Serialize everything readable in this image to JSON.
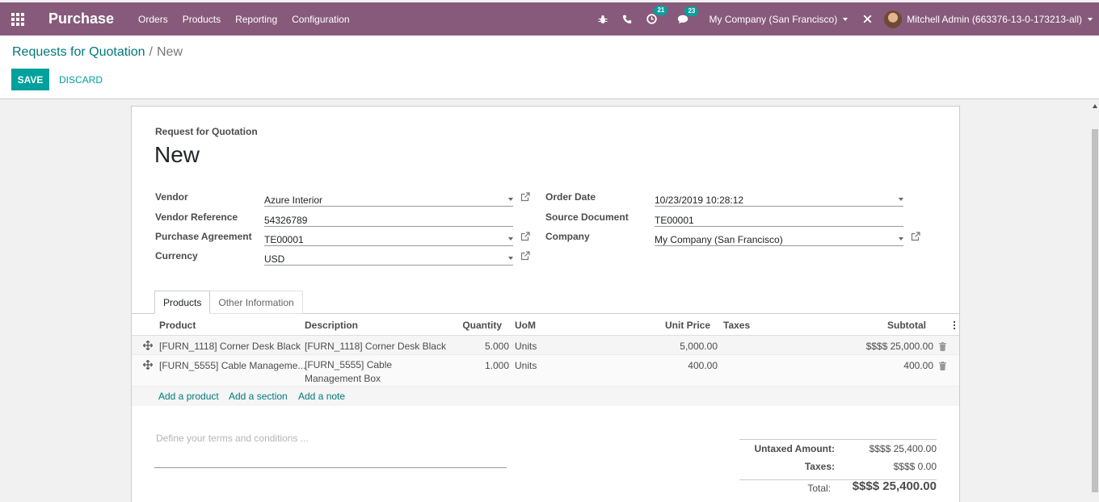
{
  "navbar": {
    "app_name": "Purchase",
    "menu": [
      "Orders",
      "Products",
      "Reporting",
      "Configuration"
    ],
    "activity_count": "21",
    "message_count": "23",
    "company": "My Company (San Francisco)",
    "user": "Mitchell Admin (663376-13-0-173213-all)",
    "icons": [
      "apps-grid-icon",
      "bug-icon",
      "phone-icon",
      "activity-clock-icon",
      "chat-icon",
      "close-icon",
      "user-avatar"
    ]
  },
  "breadcrumb": {
    "parent": "Requests for Quotation",
    "separator": "/",
    "current": "New"
  },
  "buttons": {
    "save": "SAVE",
    "discard": "DISCARD"
  },
  "form": {
    "subtitle": "Request for Quotation",
    "title": "New",
    "left_fields": [
      {
        "label": "Vendor",
        "value": "Azure Interior"
      },
      {
        "label": "Vendor Reference",
        "value": "54326789"
      },
      {
        "label": "Purchase Agreement",
        "value": "TE00001"
      },
      {
        "label": "Currency",
        "value": "USD"
      }
    ],
    "right_fields": [
      {
        "label": "Order Date",
        "value": "10/23/2019 10:28:12"
      },
      {
        "label": "Source Document",
        "value": "TE00001"
      },
      {
        "label": "Company",
        "value": "My Company (San Francisco)"
      }
    ]
  },
  "tabs": [
    "Products",
    "Other Information"
  ],
  "lines": {
    "headers": [
      "Product",
      "Description",
      "Quantity",
      "UoM",
      "Unit Price",
      "Taxes",
      "Subtotal"
    ],
    "rows": [
      {
        "product": "[FURN_1118] Corner Desk Black",
        "description_1": "[FURN_1118] Corner Desk Black",
        "description_2": "",
        "quantity": "5.000",
        "uom": "Units",
        "unit_price": "5,000.00",
        "taxes": "",
        "subtotal": "$$$$ 25,000.00"
      },
      {
        "product": "[FURN_5555] Cable Manageme...",
        "description_1": "[FURN_5555] Cable",
        "description_2": "Management Box",
        "quantity": "1.000",
        "uom": "Units",
        "unit_price": "400.00",
        "taxes": "",
        "subtotal": "400.00"
      }
    ],
    "add_links": [
      "Add a product",
      "Add a section",
      "Add a note"
    ]
  },
  "notes": {
    "placeholder": "Define your terms and conditions ..."
  },
  "totals": {
    "untaxed_label": "Untaxed Amount:",
    "untaxed_value": "$$$$ 25,400.00",
    "taxes_label": "Taxes:",
    "taxes_value": "$$$$ 0.00",
    "total_label": "Total:",
    "total_value": "$$$$ 25,400.00"
  },
  "colors": {
    "navbar": "#875a7b",
    "primary": "#00a09d",
    "link": "#00787a",
    "badge": "#00a09d"
  }
}
